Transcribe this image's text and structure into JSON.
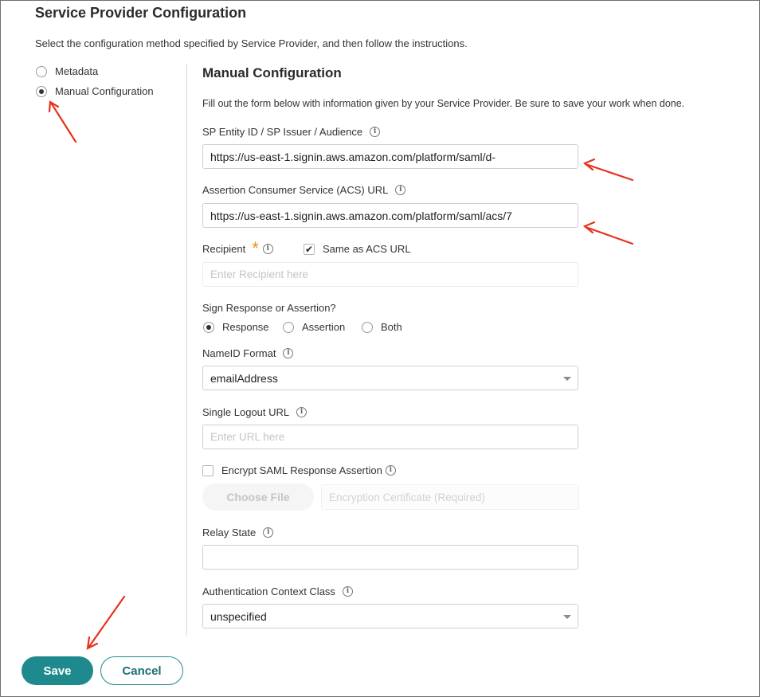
{
  "header": {
    "title": "Service Provider Configuration",
    "subtitle": "Select the configuration method specified by Service Provider, and then follow the instructions."
  },
  "method": {
    "options": [
      {
        "label": "Metadata",
        "checked": false
      },
      {
        "label": "Manual Configuration",
        "checked": true
      }
    ]
  },
  "manual": {
    "title": "Manual Configuration",
    "description": "Fill out the form below with information given by your Service Provider. Be sure to save your work when done.",
    "entity_id": {
      "label": "SP Entity ID / SP Issuer / Audience",
      "value": "https://us-east-1.signin.aws.amazon.com/platform/saml/d-"
    },
    "acs_url": {
      "label": "Assertion Consumer Service (ACS) URL",
      "value": "https://us-east-1.signin.aws.amazon.com/platform/saml/acs/7"
    },
    "recipient": {
      "label": "Recipient",
      "required_mark": "*",
      "same_as_acs_label": "Same as ACS URL",
      "same_as_acs_checked": true,
      "placeholder": "Enter Recipient here"
    },
    "sign": {
      "label": "Sign Response or Assertion?",
      "options": [
        {
          "label": "Response",
          "checked": true
        },
        {
          "label": "Assertion",
          "checked": false
        },
        {
          "label": "Both",
          "checked": false
        }
      ]
    },
    "nameid": {
      "label": "NameID Format",
      "value": "emailAddress"
    },
    "logout": {
      "label": "Single Logout URL",
      "placeholder": "Enter URL here"
    },
    "encrypt": {
      "label": "Encrypt SAML Response Assertion",
      "checked": false,
      "choose_file_label": "Choose File",
      "certificate_placeholder": "Encryption Certificate (Required)"
    },
    "relay": {
      "label": "Relay State",
      "value": ""
    },
    "auth_context": {
      "label": "Authentication Context Class",
      "value": "unspecified"
    }
  },
  "footer": {
    "save_label": "Save",
    "cancel_label": "Cancel"
  },
  "colors": {
    "accent": "#1f8a8e",
    "annotation_arrow": "#e8321e",
    "required": "#f08b1e"
  }
}
